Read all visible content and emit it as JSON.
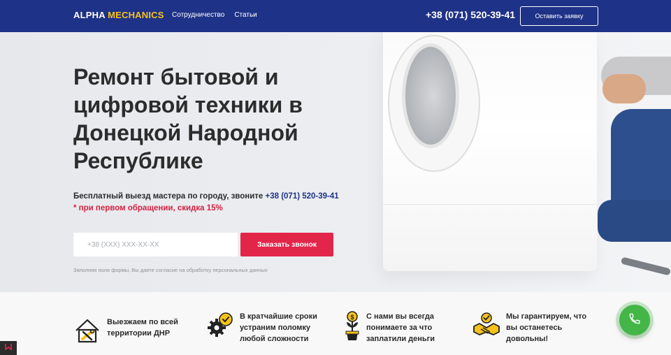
{
  "header": {
    "logo_main": "ALPHA",
    "logo_accent": "MECHANICS",
    "nav": [
      {
        "label": "Сотрудничество"
      },
      {
        "label": "Статьи"
      }
    ],
    "phone": "+38 (071) 520-39-41",
    "cta_label": "Оставить заявку"
  },
  "hero": {
    "title": "Ремонт бытовой и цифровой техники в Донецкой Народной Республике",
    "subtitle_text": "Бесплатный выезд мастера по городу, звоните ",
    "subtitle_phone": "+38 (071) 520-39-41",
    "promo": "* при первом обращении, скидка 15%",
    "phone_placeholder": "+38 (XXX) XXX-XX-XX",
    "phone_value": "",
    "call_button_label": "Заказать звонок",
    "consent_text": "Заполняя поля формы, Вы даете согласие на обработку ",
    "consent_link": "персональных данных"
  },
  "features": [
    {
      "icon": "house-tools-icon",
      "text": "Выезжаем по всей территории ДНР"
    },
    {
      "icon": "gear-check-icon",
      "text": "В кратчайшие сроки устраним поломку любой сложности"
    },
    {
      "icon": "money-plant-icon",
      "text": "С нами вы всегда понимаете за что заплатили деньги"
    },
    {
      "icon": "handshake-check-icon",
      "text": "Мы гарантируем, что вы останетесь довольны!"
    }
  ],
  "colors": {
    "header_bg": "#1e3287",
    "accent_yellow": "#f6c21b",
    "accent_red": "#e2264a",
    "fab_green": "#43b647"
  }
}
